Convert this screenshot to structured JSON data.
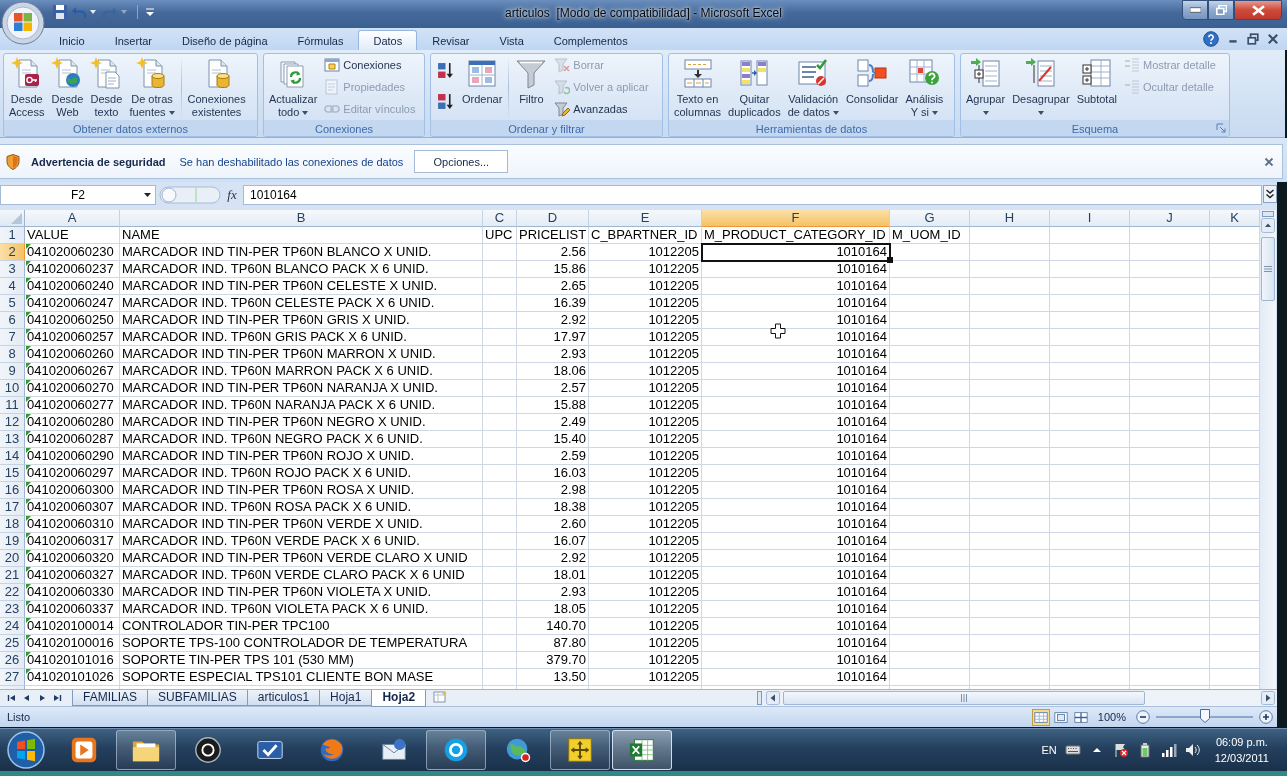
{
  "window": {
    "title": "articulos  [Modo de compatibilidad] - Microsoft Excel"
  },
  "quick_access": [
    {
      "disabled": false
    },
    {
      "disabled": false
    },
    {
      "disabled": true
    }
  ],
  "ribbon": {
    "tabs": [
      {
        "label": "Inicio",
        "selected": false
      },
      {
        "label": "Insertar",
        "selected": false
      },
      {
        "label": "Diseño de página",
        "selected": false
      },
      {
        "label": "Fórmulas",
        "selected": false
      },
      {
        "label": "Datos",
        "selected": true
      },
      {
        "label": "Revisar",
        "selected": false
      },
      {
        "label": "Vista",
        "selected": false
      },
      {
        "label": "Complementos",
        "selected": false
      }
    ],
    "groups": [
      {
        "label": "Obtener datos externos",
        "launcher": false,
        "buttons": [
          {
            "label": "Desde\nAccess",
            "kind": "large",
            "dropdown": false,
            "disabled": false
          },
          {
            "label": "Desde\nWeb",
            "kind": "large",
            "dropdown": false,
            "disabled": false
          },
          {
            "label": "Desde\ntexto",
            "kind": "large",
            "dropdown": false,
            "disabled": false
          },
          {
            "label": "De otras\nfuentes",
            "kind": "large",
            "dropdown": true,
            "disabled": false
          },
          {
            "label": "Conexiones\nexistentes",
            "kind": "large",
            "dropdown": false,
            "disabled": false
          }
        ]
      },
      {
        "label": "Conexiones",
        "launcher": false,
        "buttons": [
          {
            "label": "Actualizar\ntodo",
            "kind": "large",
            "dropdown": true,
            "disabled": false
          },
          {
            "label": "Conexiones",
            "kind": "small",
            "dropdown": false,
            "disabled": false
          },
          {
            "label": "Propiedades",
            "kind": "small",
            "dropdown": false,
            "disabled": true
          },
          {
            "label": "Editar vínculos",
            "kind": "small",
            "dropdown": false,
            "disabled": true
          }
        ]
      },
      {
        "label": "Ordenar y filtrar",
        "launcher": false,
        "buttons": [
          {
            "kind": "icon",
            "dropdown": false,
            "disabled": false
          },
          {
            "kind": "icon",
            "dropdown": false,
            "disabled": false
          },
          {
            "label": "Ordenar",
            "kind": "large",
            "dropdown": false,
            "disabled": false
          },
          {
            "label": "Filtro",
            "kind": "large",
            "dropdown": false,
            "disabled": false
          },
          {
            "label": "Borrar",
            "kind": "small",
            "dropdown": false,
            "disabled": true
          },
          {
            "label": "Volver a aplicar",
            "kind": "small",
            "dropdown": false,
            "disabled": true
          },
          {
            "label": "Avanzadas",
            "kind": "small",
            "dropdown": false,
            "disabled": false
          }
        ]
      },
      {
        "label": "Herramientas de datos",
        "launcher": false,
        "buttons": [
          {
            "label": "Texto en\ncolumnas",
            "kind": "large",
            "dropdown": false,
            "disabled": false
          },
          {
            "label": "Quitar\nduplicados",
            "kind": "large",
            "dropdown": false,
            "disabled": false
          },
          {
            "label": "Validación\nde datos",
            "kind": "large",
            "dropdown": true,
            "disabled": false
          },
          {
            "label": "Consolidar",
            "kind": "large",
            "dropdown": false,
            "disabled": false
          },
          {
            "label": "Análisis\nY si",
            "kind": "large",
            "dropdown": true,
            "disabled": false
          }
        ]
      },
      {
        "label": "Esquema",
        "launcher": true,
        "buttons": [
          {
            "label": "Agrupar",
            "kind": "large",
            "dropdown": true,
            "disabled": false
          },
          {
            "label": "Desagrupar",
            "kind": "large",
            "dropdown": true,
            "disabled": false
          },
          {
            "label": "Subtotal",
            "kind": "large",
            "dropdown": false,
            "disabled": false
          },
          {
            "label": "Mostrar detalle",
            "kind": "small",
            "dropdown": false,
            "disabled": true
          },
          {
            "label": "Ocultar detalle",
            "kind": "small",
            "dropdown": false,
            "disabled": true
          }
        ]
      }
    ]
  },
  "security_bar": {
    "title": "Advertencia de seguridad",
    "message": "Se han deshabilitado las conexiones de datos",
    "button": "Opciones..."
  },
  "formula_bar": {
    "name_box": "F2",
    "function_button": "fx",
    "value": "1010164"
  },
  "sheet": {
    "columns": [
      {
        "letter": "A",
        "selected": false
      },
      {
        "letter": "B",
        "selected": false
      },
      {
        "letter": "C",
        "selected": false
      },
      {
        "letter": "D",
        "selected": false
      },
      {
        "letter": "E",
        "selected": false
      },
      {
        "letter": "F",
        "selected": true
      },
      {
        "letter": "G",
        "selected": false
      },
      {
        "letter": "H",
        "selected": false
      },
      {
        "letter": "I",
        "selected": false
      },
      {
        "letter": "J",
        "selected": false
      },
      {
        "letter": "K",
        "selected": false
      }
    ],
    "rows": [
      {
        "number": "1",
        "selected": false,
        "kind": "labels",
        "flagged": false,
        "cells": {
          "a": "VALUE",
          "b": "NAME",
          "c": "UPC",
          "d": "PRICELIST",
          "e": "C_BPARTNER_ID",
          "f": "M_PRODUCT_CATEGORY_ID",
          "g": "M_UOM_ID"
        }
      },
      {
        "number": "2",
        "selected": true,
        "kind": "record",
        "flagged": true,
        "cells": {
          "a": "041020060230",
          "b": "MARCADOR IND TIN-PER TP60N BLANCO X UNID.",
          "d": "2.56",
          "e": "1012205",
          "f": "1010164"
        }
      },
      {
        "number": "3",
        "selected": false,
        "kind": "record",
        "flagged": true,
        "cells": {
          "a": "041020060237",
          "b": "MARCADOR IND. TP60N BLANCO PACK X 6 UNID.",
          "d": "15.86",
          "e": "1012205",
          "f": "1010164"
        }
      },
      {
        "number": "4",
        "selected": false,
        "kind": "record",
        "flagged": true,
        "cells": {
          "a": "041020060240",
          "b": "MARCADOR IND TIN-PER TP60N CELESTE X UNID.",
          "d": "2.65",
          "e": "1012205",
          "f": "1010164"
        }
      },
      {
        "number": "5",
        "selected": false,
        "kind": "record",
        "flagged": true,
        "cells": {
          "a": "041020060247",
          "b": "MARCADOR IND. TP60N CELESTE PACK X 6 UNID.",
          "d": "16.39",
          "e": "1012205",
          "f": "1010164"
        }
      },
      {
        "number": "6",
        "selected": false,
        "kind": "record",
        "flagged": true,
        "cells": {
          "a": "041020060250",
          "b": "MARCADOR IND TIN-PER TP60N GRIS X UNID.",
          "d": "2.92",
          "e": "1012205",
          "f": "1010164"
        }
      },
      {
        "number": "7",
        "selected": false,
        "kind": "record",
        "flagged": true,
        "cells": {
          "a": "041020060257",
          "b": "MARCADOR IND. TP60N GRIS PACK X 6 UNID.",
          "d": "17.97",
          "e": "1012205",
          "f": "1010164"
        }
      },
      {
        "number": "8",
        "selected": false,
        "kind": "record",
        "flagged": true,
        "cells": {
          "a": "041020060260",
          "b": "MARCADOR IND TIN-PER TP60N MARRON X UNID.",
          "d": "2.93",
          "e": "1012205",
          "f": "1010164"
        }
      },
      {
        "number": "9",
        "selected": false,
        "kind": "record",
        "flagged": true,
        "cells": {
          "a": "041020060267",
          "b": "MARCADOR IND. TP60N MARRON PACK X 6 UNID.",
          "d": "18.06",
          "e": "1012205",
          "f": "1010164"
        }
      },
      {
        "number": "10",
        "selected": false,
        "kind": "record",
        "flagged": true,
        "cells": {
          "a": "041020060270",
          "b": "MARCADOR IND TIN-PER TP60N NARANJA X UNID.",
          "d": "2.57",
          "e": "1012205",
          "f": "1010164"
        }
      },
      {
        "number": "11",
        "selected": false,
        "kind": "record",
        "flagged": true,
        "cells": {
          "a": "041020060277",
          "b": "MARCADOR IND. TP60N NARANJA PACK X 6 UNID.",
          "d": "15.88",
          "e": "1012205",
          "f": "1010164"
        }
      },
      {
        "number": "12",
        "selected": false,
        "kind": "record",
        "flagged": true,
        "cells": {
          "a": "041020060280",
          "b": "MARCADOR IND TIN-PER TP60N NEGRO X UNID.",
          "d": "2.49",
          "e": "1012205",
          "f": "1010164"
        }
      },
      {
        "number": "13",
        "selected": false,
        "kind": "record",
        "flagged": true,
        "cells": {
          "a": "041020060287",
          "b": "MARCADOR IND. TP60N NEGRO PACK X 6 UNID.",
          "d": "15.40",
          "e": "1012205",
          "f": "1010164"
        }
      },
      {
        "number": "14",
        "selected": false,
        "kind": "record",
        "flagged": true,
        "cells": {
          "a": "041020060290",
          "b": "MARCADOR IND TIN-PER TP60N ROJO X UNID.",
          "d": "2.59",
          "e": "1012205",
          "f": "1010164"
        }
      },
      {
        "number": "15",
        "selected": false,
        "kind": "record",
        "flagged": true,
        "cells": {
          "a": "041020060297",
          "b": "MARCADOR IND. TP60N ROJO PACK X 6 UNID.",
          "d": "16.03",
          "e": "1012205",
          "f": "1010164"
        }
      },
      {
        "number": "16",
        "selected": false,
        "kind": "record",
        "flagged": true,
        "cells": {
          "a": "041020060300",
          "b": "MARCADOR IND TIN-PER TP60N ROSA X UNID.",
          "d": "2.98",
          "e": "1012205",
          "f": "1010164"
        }
      },
      {
        "number": "17",
        "selected": false,
        "kind": "record",
        "flagged": true,
        "cells": {
          "a": "041020060307",
          "b": "MARCADOR IND. TP60N ROSA PACK X 6 UNID.",
          "d": "18.38",
          "e": "1012205",
          "f": "1010164"
        }
      },
      {
        "number": "18",
        "selected": false,
        "kind": "record",
        "flagged": true,
        "cells": {
          "a": "041020060310",
          "b": "MARCADOR IND TIN-PER TP60N VERDE X UNID.",
          "d": "2.60",
          "e": "1012205",
          "f": "1010164"
        }
      },
      {
        "number": "19",
        "selected": false,
        "kind": "record",
        "flagged": true,
        "cells": {
          "a": "041020060317",
          "b": "MARCADOR IND. TP60N VERDE PACK X 6 UNID.",
          "d": "16.07",
          "e": "1012205",
          "f": "1010164"
        }
      },
      {
        "number": "20",
        "selected": false,
        "kind": "record",
        "flagged": true,
        "cells": {
          "a": "041020060320",
          "b": "MARCADOR IND TIN-PER TP60N VERDE CLARO X UNID",
          "d": "2.92",
          "e": "1012205",
          "f": "1010164"
        }
      },
      {
        "number": "21",
        "selected": false,
        "kind": "record",
        "flagged": true,
        "cells": {
          "a": "041020060327",
          "b": "MARCADOR IND. TP60N VERDE CLARO PACK X 6 UNID",
          "d": "18.01",
          "e": "1012205",
          "f": "1010164"
        }
      },
      {
        "number": "22",
        "selected": false,
        "kind": "record",
        "flagged": true,
        "cells": {
          "a": "041020060330",
          "b": "MARCADOR IND TIN-PER TP60N VIOLETA X UNID.",
          "d": "2.93",
          "e": "1012205",
          "f": "1010164"
        }
      },
      {
        "number": "23",
        "selected": false,
        "kind": "record",
        "flagged": true,
        "cells": {
          "a": "041020060337",
          "b": "MARCADOR IND. TP60N VIOLETA PACK X 6 UNID.",
          "d": "18.05",
          "e": "1012205",
          "f": "1010164"
        }
      },
      {
        "number": "24",
        "selected": false,
        "kind": "record",
        "flagged": true,
        "cells": {
          "a": "041020100014",
          "b": "CONTROLADOR TIN-PER TPC100",
          "d": "140.70",
          "e": "1012205",
          "f": "1010164"
        }
      },
      {
        "number": "25",
        "selected": false,
        "kind": "record",
        "flagged": true,
        "cells": {
          "a": "041020100016",
          "b": "SOPORTE TPS-100 CONTROLADOR DE TEMPERATURA",
          "d": "87.80",
          "e": "1012205",
          "f": "1010164"
        }
      },
      {
        "number": "26",
        "selected": false,
        "kind": "record",
        "flagged": true,
        "cells": {
          "a": "041020101016",
          "b": "SOPORTE TIN-PER TPS 101 (530 MM)",
          "d": "379.70",
          "e": "1012205",
          "f": "1010164"
        }
      },
      {
        "number": "27",
        "selected": false,
        "kind": "record",
        "flagged": true,
        "cells": {
          "a": "041020101026",
          "b": "SOPORTE ESPECIAL TPS101 CLIENTE BON MASE",
          "d": "13.50",
          "e": "1012205",
          "f": "1010164"
        }
      }
    ]
  },
  "sheet_tabs": [
    {
      "label": "FAMILIAS",
      "selected": false
    },
    {
      "label": "SUBFAMILIAS",
      "selected": false
    },
    {
      "label": "articulos1",
      "selected": false
    },
    {
      "label": "Hoja1",
      "selected": false
    },
    {
      "label": "Hoja2",
      "selected": true
    }
  ],
  "status_bar": {
    "text": "Listo",
    "views": [
      {
        "selected": true
      },
      {
        "selected": false
      },
      {
        "selected": false
      }
    ],
    "zoom": {
      "label": "100%",
      "level": 0.5
    }
  },
  "taskbar": {
    "apps": [
      {
        "running": false,
        "selected": false
      },
      {
        "running": true,
        "selected": false
      },
      {
        "running": false,
        "selected": false
      },
      {
        "running": false,
        "selected": false
      },
      {
        "running": false,
        "selected": false
      },
      {
        "running": false,
        "selected": false
      },
      {
        "running": true,
        "selected": false
      },
      {
        "running": false,
        "selected": false
      },
      {
        "running": true,
        "selected": false
      },
      {
        "running": true,
        "selected": true
      }
    ],
    "language": "EN",
    "time": "06:09 p.m.",
    "date": "12/03/2011"
  }
}
